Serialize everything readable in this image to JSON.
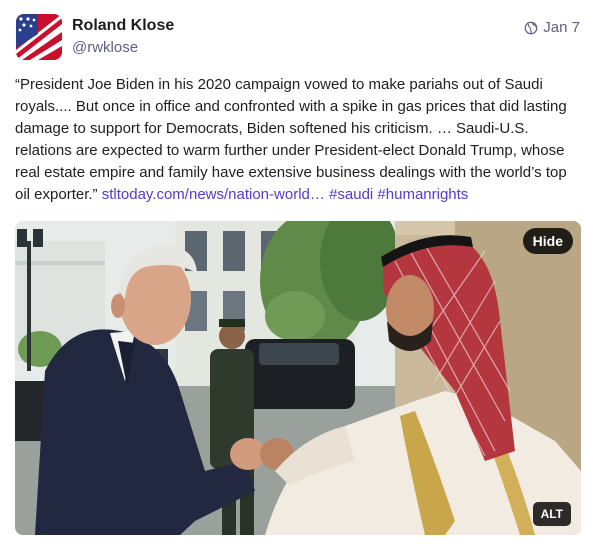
{
  "author": {
    "display_name": "Roland Klose",
    "handle": "@rwklose",
    "avatar_icon": "flag-avatar"
  },
  "meta": {
    "visibility_icon": "globe-icon",
    "date": "Jan 7"
  },
  "post": {
    "text": "“President Joe Biden in his 2020 campaign vowed to make pariahs out of Saudi royals.... But once in office and confronted with a spike in gas prices that did lasting damage to support for Democrats, Biden softened his criticism. … Saudi-U.S. relations are expected to warm further under President-elect Donald Trump, whose real estate empire and family have extensive business dealings with the world’s top oil exporter.”",
    "link": "stltoday.com/news/nation-world…",
    "hashtags": [
      "#saudi",
      "#humanrights"
    ]
  },
  "media": {
    "hide_label": "Hide",
    "alt_label": "ALT"
  },
  "colors": {
    "link": "#563acc",
    "muted": "#606085",
    "text": "#1e1e21"
  }
}
